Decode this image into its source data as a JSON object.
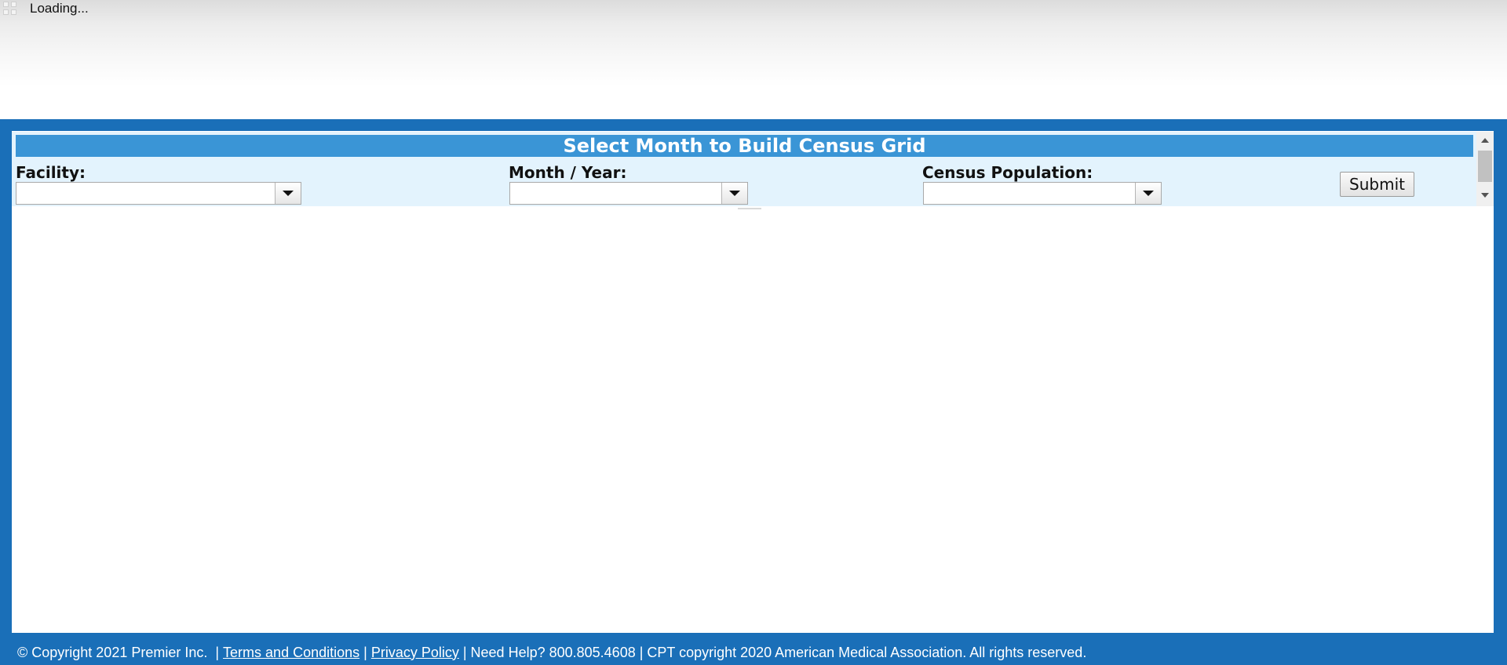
{
  "header": {
    "loading_text": "Loading..."
  },
  "panel": {
    "title": "Select Month to Build Census Grid",
    "facility": {
      "label": "Facility:",
      "value": ""
    },
    "month_year": {
      "label": "Month / Year:",
      "value": ""
    },
    "census_population": {
      "label": "Census Population:",
      "value": ""
    },
    "submit_label": "Submit"
  },
  "footer": {
    "copyright": "© Copyright 2021 Premier Inc.  | ",
    "terms": "Terms and Conditions",
    "sep1": " | ",
    "privacy": "Privacy Policy",
    "rest": " | Need Help? 800.805.4608 | CPT copyright 2020 American Medical Association. All rights reserved."
  },
  "colors": {
    "frame_blue": "#1a6fb8",
    "title_blue": "#3a95d6",
    "panel_bg": "#e3f3fd"
  }
}
